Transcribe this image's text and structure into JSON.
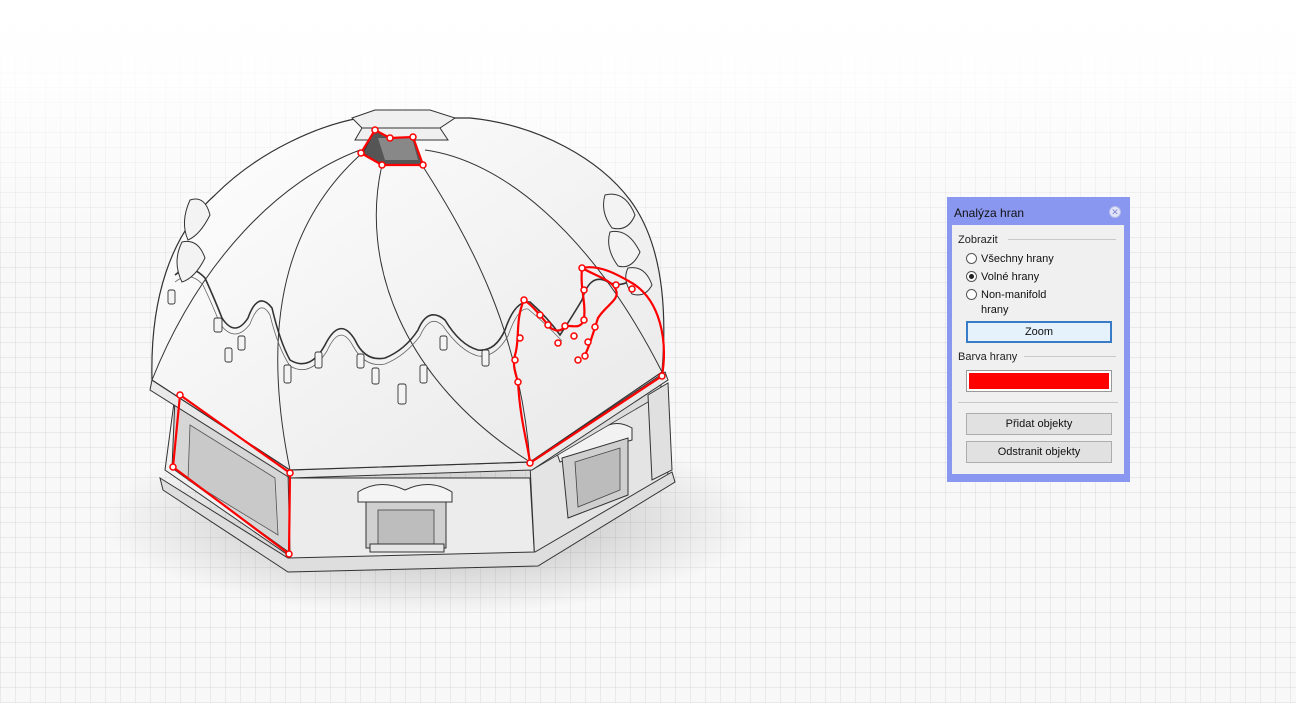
{
  "panel": {
    "title": "Analýza hran",
    "show_group_label": "Zobrazit",
    "options": [
      {
        "label": "Všechny hrany",
        "selected": false
      },
      {
        "label": "Volné hrany",
        "selected": true
      },
      {
        "label": "Non-manifold",
        "label2": "hrany",
        "selected": false
      }
    ],
    "zoom_button": "Zoom",
    "edge_color_label": "Barva hrany",
    "edge_color": "#ff0000",
    "add_objects_button": "Přidat objekty",
    "remove_objects_button": "Odstranit objekty"
  },
  "viewport": {
    "highlight_color": "#ff0000",
    "title_bar_color": "#8a97f0"
  }
}
